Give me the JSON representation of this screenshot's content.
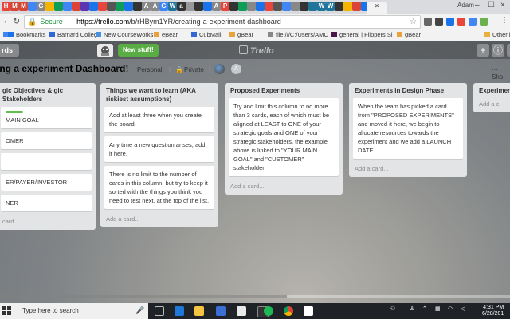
{
  "browser": {
    "tabs_visible": [
      "H",
      "M",
      "M",
      "",
      "G",
      "",
      "",
      "",
      "",
      "",
      "",
      "",
      "",
      "",
      "",
      "",
      "A",
      "A",
      "G",
      "W",
      "a",
      "",
      "",
      "",
      "A",
      "P",
      "",
      "",
      "",
      "",
      "",
      "",
      "",
      "",
      "",
      "",
      "W",
      "W",
      "",
      "",
      "",
      "",
      "A"
    ],
    "active_tab_close": "×",
    "user": "Adam",
    "window_controls": [
      "–",
      "☐",
      "×"
    ],
    "secure_label": "Secure",
    "url_host": "https://trello.com",
    "url_path": "/b/rHBym1YR/creating-a-experiment-dashboard",
    "bookmarks": [
      {
        "label": "Bookmarks",
        "icon": "star-icon",
        "color": "#1a73e8"
      },
      {
        "label": "Barnard College",
        "icon": "b-icon",
        "color": "#3367d6"
      },
      {
        "label": "New CourseWorks",
        "icon": "c-icon",
        "color": "#4a90e2"
      },
      {
        "label": "eBear",
        "icon": "e-icon",
        "color": "#e8a33d"
      },
      {
        "label": "CubMail",
        "icon": "mail-icon",
        "color": "#3367d6"
      },
      {
        "label": "gBear",
        "icon": "g-icon",
        "color": "#e8a33d"
      },
      {
        "label": "file:///C:/Users/AMC",
        "icon": "file-icon",
        "color": "#888888"
      },
      {
        "label": "general | Flippers Sl",
        "icon": "slack-icon",
        "color": "#4a154b"
      },
      {
        "label": "gBear",
        "icon": "g-icon",
        "color": "#e8a33d"
      },
      {
        "label": "Other b",
        "icon": "folder-icon",
        "color": "#e8b33d"
      }
    ]
  },
  "trello": {
    "boards_button": "rds",
    "new_stuff": "New stuff!",
    "logo": "Trello",
    "board_title": "ing a experiment Dashboard!",
    "personal": "Personal",
    "private": "Private",
    "show_menu": "Sho",
    "lists": [
      {
        "title": "gic Objectives & gic Stakeholders",
        "cards": [
          " MAIN GOAL",
          "OMER",
          "",
          "ER/PAYER/INVESTOR",
          "NER"
        ],
        "add": "card..."
      },
      {
        "title": "Things we want to learn (AKA riskiest assumptions)",
        "cards": [
          "Add at least three when you create the board.",
          "Any time a new question arises, add it here.",
          "There is no limit to the number of cards in this column, but try to keep it sorted with the things you think you need to test next, at the top of the list."
        ],
        "add": "Add a card..."
      },
      {
        "title": "Proposed Experiments",
        "cards": [
          "Try and limit this column to no more than 3 cards, each of which must be aligned at LEAST to ONE of your strategic goals and ONE of your strategic stakeholders, the example above is linked to \"YOUR MAIN GOAL\" and \"CUSTOMER\" stakeholder."
        ],
        "add": "Add a card..."
      },
      {
        "title": "Experiments in Design Phase",
        "cards": [
          "When the team has picked a card from \"PROPOSED EXPERIMENTS\" and moved it here, we begin to allocate resources towards the experiment and we add a LAUNCH DATE."
        ],
        "add": "Add a card..."
      },
      {
        "title": "Experimen",
        "cards": [],
        "add": "Add a c"
      }
    ]
  },
  "taskbar": {
    "search_placeholder": "Type here to search",
    "time": "4:31 PM",
    "date": "6/28/201"
  }
}
